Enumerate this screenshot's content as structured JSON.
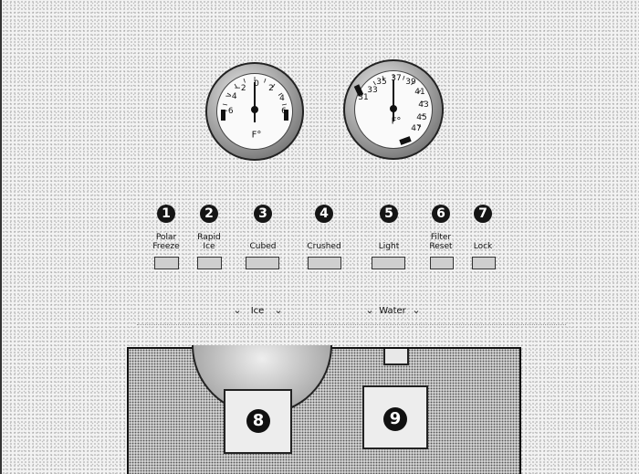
{
  "gauges": [
    {
      "name": "freezer-gauge",
      "unit": "F°",
      "ticks": [
        "−4",
        "−2",
        "0",
        "2",
        "4",
        "−6",
        "6"
      ]
    },
    {
      "name": "fresh-food-gauge",
      "unit": "F°",
      "ticks": [
        "33",
        "35",
        "37",
        "39",
        "41",
        "31",
        "43",
        "45",
        "47"
      ]
    }
  ],
  "buttons": [
    {
      "num": "1",
      "label_line1": "Polar",
      "label_line2": "Freeze"
    },
    {
      "num": "2",
      "label_line1": "Rapid",
      "label_line2": "Ice"
    },
    {
      "num": "3",
      "label_line1": "Cubed",
      "label_line2": ""
    },
    {
      "num": "4",
      "label_line1": "Crushed",
      "label_line2": ""
    },
    {
      "num": "5",
      "label_line1": "Light",
      "label_line2": ""
    },
    {
      "num": "6",
      "label_line1": "Filter",
      "label_line2": "Reset"
    },
    {
      "num": "7",
      "label_line1": "Lock",
      "label_line2": ""
    }
  ],
  "dispense": {
    "ice_label": "Ice",
    "water_label": "Water",
    "chevron": "⌄"
  },
  "paddles": {
    "ice_num": "8",
    "water_num": "9"
  },
  "colors": {
    "badge": "#151515",
    "pad": "#cfcfcf"
  }
}
